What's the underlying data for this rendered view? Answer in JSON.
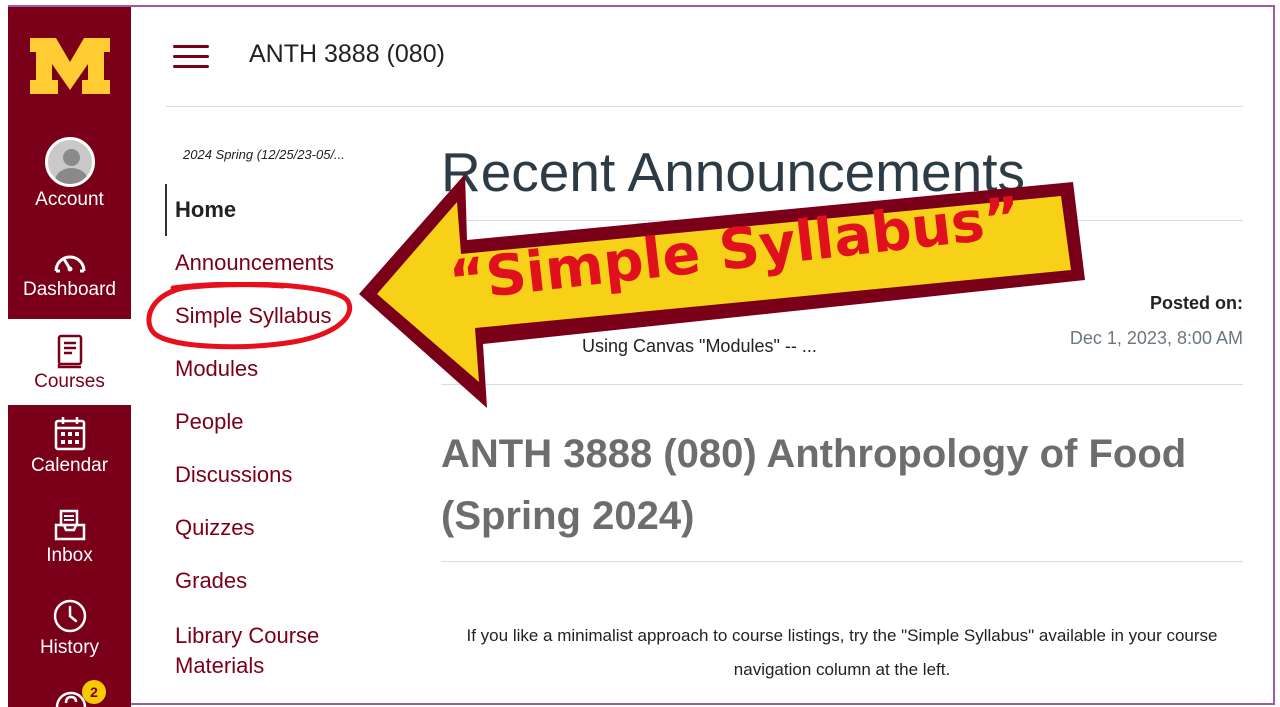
{
  "global_nav": {
    "logo": "M",
    "items": [
      {
        "label": "Account",
        "icon": "account-avatar-icon"
      },
      {
        "label": "Dashboard",
        "icon": "dashboard-gauge-icon"
      },
      {
        "label": "Courses",
        "icon": "courses-book-icon",
        "active": true
      },
      {
        "label": "Calendar",
        "icon": "calendar-icon"
      },
      {
        "label": "Inbox",
        "icon": "inbox-icon"
      },
      {
        "label": "History",
        "icon": "history-clock-icon"
      }
    ],
    "help_badge": "2"
  },
  "header": {
    "breadcrumb": "ANTH 3888 (080)"
  },
  "course_nav": {
    "term": "2024 Spring (12/25/23-05/...",
    "items": [
      {
        "label": "Home",
        "active": true
      },
      {
        "label": "Announcements"
      },
      {
        "label": "Simple Syllabus",
        "highlighted": true
      },
      {
        "label": "Modules"
      },
      {
        "label": "People"
      },
      {
        "label": "Discussions"
      },
      {
        "label": "Quizzes"
      },
      {
        "label": "Grades"
      },
      {
        "label": "Library Course Materials"
      }
    ]
  },
  "main": {
    "recent_announcements_title": "Recent Announcements",
    "announcement": {
      "title": "Using Canvas \"Modules\" -- ...",
      "posted_label": "Posted on:",
      "posted_date": "Dec 1, 2023, 8:00 AM"
    },
    "course_title": "ANTH 3888 (080) Anthropology of Food (Spring 2024)",
    "description": "If you like a minimalist approach to course listings, try the \"Simple Syllabus\" available in your course navigation column at the left."
  },
  "callout": {
    "text": "“Simple Syllabus”"
  },
  "colors": {
    "maroon": "#7a0019",
    "gold": "#ffcc33",
    "callout_yellow": "#f7d117",
    "callout_text": "#e0111c",
    "highlight_circle": "#e5101b"
  }
}
